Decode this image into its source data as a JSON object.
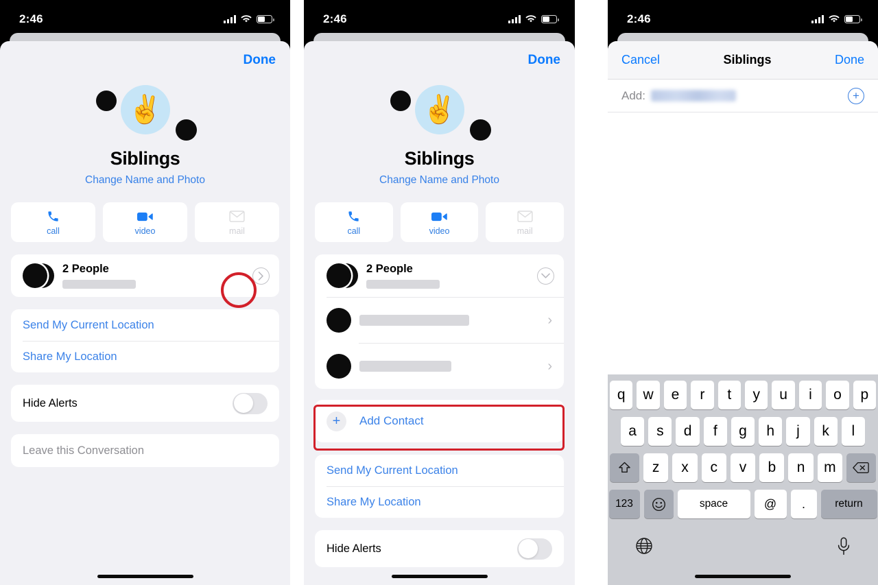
{
  "status_bar": {
    "time": "2:46",
    "icons": [
      "cellular-bars-icon",
      "wifi-icon",
      "battery-icon"
    ]
  },
  "panel1": {
    "done_label": "Done",
    "group": {
      "emoji": "✌️",
      "name": "Siblings",
      "change_link": "Change Name and Photo"
    },
    "tiles": [
      {
        "label": "call",
        "icon": "phone-icon",
        "disabled": false
      },
      {
        "label": "video",
        "icon": "video-icon",
        "disabled": false
      },
      {
        "label": "mail",
        "icon": "mail-icon",
        "disabled": true
      }
    ],
    "people_row": {
      "title": "2 People",
      "chevron": "chevron-right-icon"
    },
    "location": [
      "Send My Current Location",
      "Share My Location"
    ],
    "hide_alerts": {
      "label": "Hide Alerts",
      "state": "off"
    },
    "leave": "Leave this Conversation",
    "annotation": {
      "type": "circle",
      "color": "#d2202a",
      "target": "people-disclosure-button"
    }
  },
  "panel2": {
    "done_label": "Done",
    "group": {
      "emoji": "✌️",
      "name": "Siblings",
      "change_link": "Change Name and Photo"
    },
    "tiles": [
      {
        "label": "call",
        "icon": "phone-icon",
        "disabled": false
      },
      {
        "label": "video",
        "icon": "video-icon",
        "disabled": false
      },
      {
        "label": "mail",
        "icon": "mail-icon",
        "disabled": true
      }
    ],
    "people_row": {
      "title": "2 People",
      "chevron": "chevron-down-icon"
    },
    "contacts": [
      {
        "name_redacted": true
      },
      {
        "name_redacted": true
      }
    ],
    "add_contact": {
      "label": "Add Contact",
      "icon": "plus-icon"
    },
    "location": [
      "Send My Current Location",
      "Share My Location"
    ],
    "hide_alerts": {
      "label": "Hide Alerts",
      "state": "off"
    },
    "annotation": {
      "type": "rectangle",
      "color": "#d2202a",
      "target": "add-contact-row"
    }
  },
  "panel3": {
    "nav": {
      "cancel": "Cancel",
      "title": "Siblings",
      "done": "Done"
    },
    "add_field": {
      "label": "Add:",
      "value_redacted": true,
      "add_icon": "plus-circle-icon"
    },
    "keyboard": {
      "row1": [
        "q",
        "w",
        "e",
        "r",
        "t",
        "y",
        "u",
        "i",
        "o",
        "p"
      ],
      "row2": [
        "a",
        "s",
        "d",
        "f",
        "g",
        "h",
        "j",
        "k",
        "l"
      ],
      "row3": [
        "z",
        "x",
        "c",
        "v",
        "b",
        "n",
        "m"
      ],
      "shift_icon": "shift-icon",
      "backspace_icon": "backspace-icon",
      "numbers_label": "123",
      "emoji_icon": "emoji-icon",
      "space_label": "space",
      "at_label": "@",
      "dot_label": ".",
      "return_label": "return",
      "globe_icon": "globe-icon",
      "mic_icon": "microphone-icon"
    }
  },
  "colors": {
    "accent": "#0a7aff",
    "link": "#3b82e8",
    "annotation": "#d2202a",
    "sheet_bg": "#f1f1f5"
  }
}
